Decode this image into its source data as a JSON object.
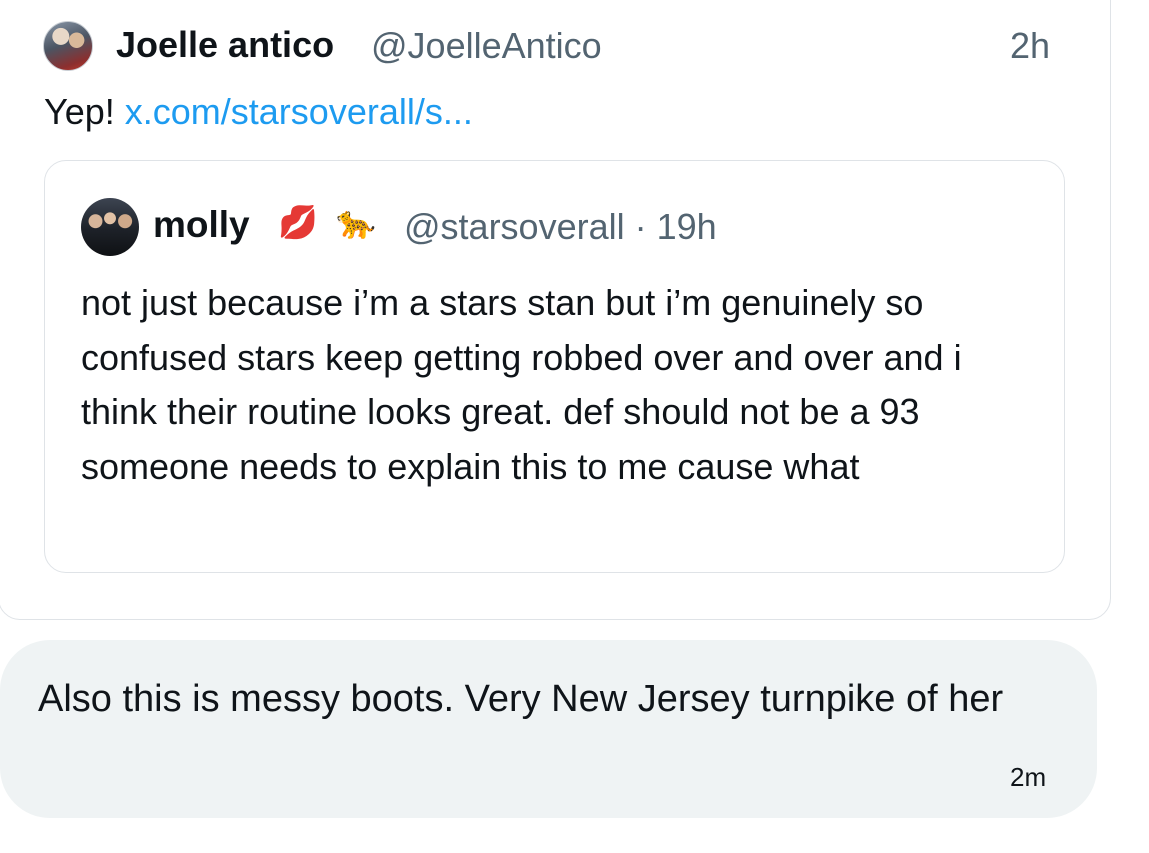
{
  "shared_post": {
    "author_name": "Joelle antico",
    "author_handle": "@JoelleAntico",
    "time": "2h",
    "text_prefix": "Yep! ",
    "link_text": "x.com/starsoverall/s...",
    "avatar_icon": "profile-photo",
    "quoted_post": {
      "author_name": "molly",
      "name_emojis": [
        "💋",
        "🐆"
      ],
      "handle_time": "@starsoverall · 19h",
      "avatar_icon": "profile-photo",
      "text": "not just because i’m a stars stan but i’m genuinely so confused stars keep getting robbed over and over and i think their routine looks great. def should not be a 93 someone needs to explain this to me cause what"
    }
  },
  "message": {
    "text": "Also this is messy boots. Very New Jersey turnpike of her",
    "time": "2m"
  },
  "colors": {
    "link": "#1d9bf0",
    "secondary_text": "#536471",
    "bubble_bg": "#eff3f4",
    "border": "#dfe3e7"
  }
}
